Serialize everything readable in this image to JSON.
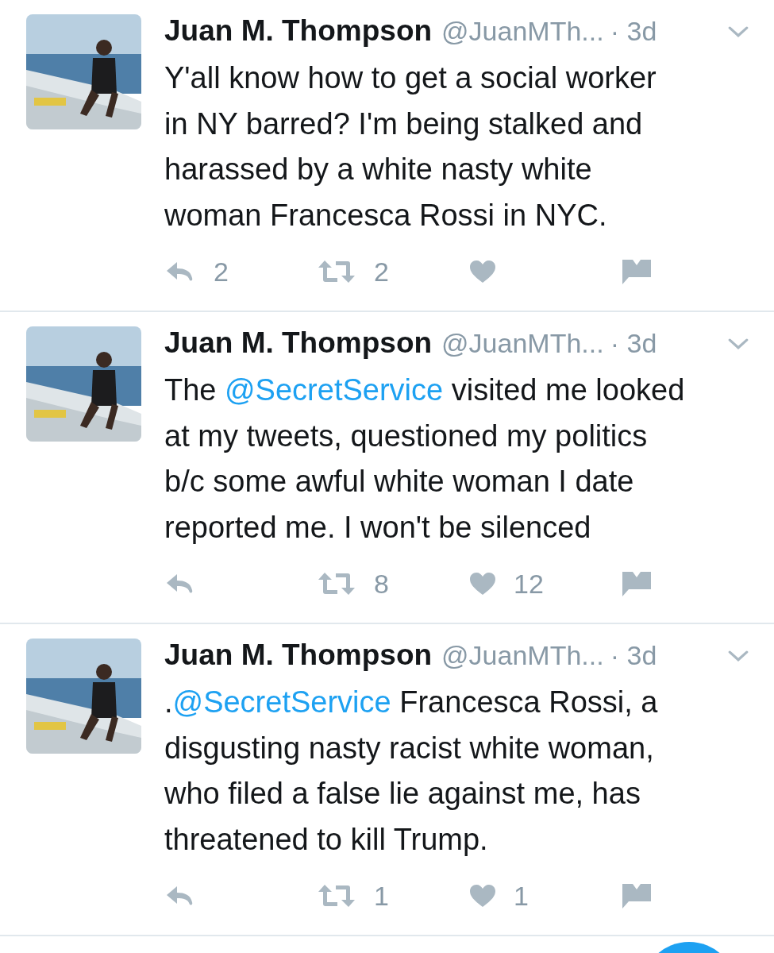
{
  "tweets": [
    {
      "name": "Juan M. Thompson",
      "handle": "@JuanMTh...",
      "time": "· 3d",
      "lines": [
        [
          {
            "text": "Y'all know how to get a social worker"
          }
        ],
        [
          {
            "text": "in NY barred? I'm being stalked and"
          }
        ],
        [
          {
            "text": "harassed by a white nasty white"
          }
        ],
        [
          {
            "text": "woman Francesca Rossi in NYC."
          }
        ]
      ],
      "replies": "2",
      "retweets": "2"
    },
    {
      "name": "Juan M. Thompson",
      "handle": "@JuanMTh...",
      "time": "· 3d",
      "lines": [
        [
          {
            "text": "The "
          },
          {
            "text": "@SecretService",
            "kind": "mention"
          },
          {
            "text": " visited me looked"
          }
        ],
        [
          {
            "text": "at my tweets, questioned my politics"
          }
        ],
        [
          {
            "text": "b/c some awful white woman I date"
          }
        ],
        [
          {
            "text": "reported me. I won't be silenced"
          }
        ]
      ],
      "retweets": "8",
      "likes": "12"
    },
    {
      "name": "Juan M. Thompson",
      "handle": "@JuanMTh...",
      "time": "· 3d",
      "lines": [
        [
          {
            "text": "."
          },
          {
            "text": "@SecretService",
            "kind": "mention"
          },
          {
            "text": " Francesca Rossi, a"
          }
        ],
        [
          {
            "text": "disgusting nasty racist white woman,"
          }
        ],
        [
          {
            "text": "who filed a false lie against me, has"
          }
        ],
        [
          {
            "text": "threatened to kill Trump."
          }
        ]
      ],
      "retweets": "1",
      "likes": "1"
    }
  ],
  "compose_button": {
    "visible": true
  }
}
